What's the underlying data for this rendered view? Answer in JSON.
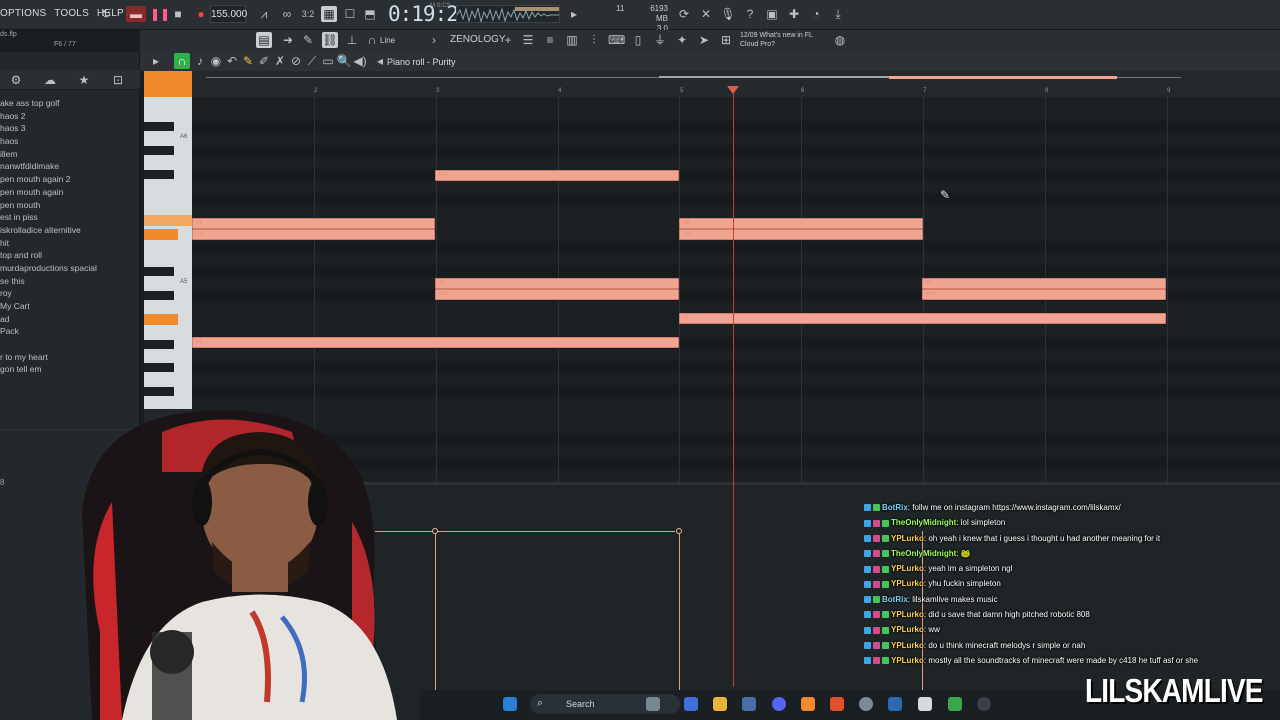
{
  "menus": [
    "OPTIONS",
    "TOOLS",
    "HELP"
  ],
  "transport": {
    "tempo": "155.000",
    "time": "0:19:28",
    "time_sub": "M:S:CS",
    "cpu": "11",
    "mem_top": "6193 MB",
    "mem_bottom": "3 0"
  },
  "plugin": "ZENOLOGY",
  "snap_label": "Line",
  "news": {
    "line1": "12/09  What's new in FL",
    "line2": "Cloud Pro?"
  },
  "file": {
    "name": "ds.flp",
    "pattern": "F6 / 77"
  },
  "piano_roll": {
    "title": "Piano roll - Purity"
  },
  "ruler": [
    "2",
    "3",
    "4",
    "5",
    "6",
    "7",
    "8",
    "9"
  ],
  "key_labels": [
    "A6",
    "A5"
  ],
  "browser_items": [
    "ake ass top golf",
    "haos 2",
    "haos 3",
    "haos",
    "illem",
    "nanwtfdidimake",
    "pen mouth again 2",
    "pen mouth again",
    "pen mouth",
    "est in piss",
    "iskrolladice alternitive",
    "hit",
    "top and roll",
    "murdaproductions spacial",
    "se this",
    "roy",
    "My Cart",
    "ad",
    "Pack",
    "",
    "r to my heart",
    "gon tell em"
  ],
  "browser_number": "8",
  "notes": [
    {
      "label": "F#6"
    },
    {
      "label": "D6"
    },
    {
      "label": "C#6"
    },
    {
      "label": "D6"
    },
    {
      "label": "C#6"
    },
    {
      "label": "A5"
    },
    {
      "label": "G#5"
    },
    {
      "label": "A5"
    },
    {
      "label": "G#5"
    },
    {
      "label": "F5"
    },
    {
      "label": "E5"
    }
  ],
  "chat": [
    {
      "user": "BotRix",
      "color": "#7fd3ff",
      "text": ": follw me on instagram https://www.instagram.com/lilskamx/"
    },
    {
      "user": "TheOnlyMidnight",
      "color": "#9cff59",
      "text": ": lol simpleton"
    },
    {
      "user": "YPLurko",
      "color": "#ffd04a",
      "text": ": oh yeah i knew that i guess i thought u had another meaning for it"
    },
    {
      "user": "TheOnlyMidnight",
      "color": "#9cff59",
      "text": ": 🐸"
    },
    {
      "user": "YPLurko",
      "color": "#ffd04a",
      "text": ": yeah im a simpleton ngl"
    },
    {
      "user": "YPLurko",
      "color": "#ffd04a",
      "text": ": yhu fuckin simpleton"
    },
    {
      "user": "BotRix",
      "color": "#7fd3ff",
      "text": ": lilskamlive makes music"
    },
    {
      "user": "YPLurko",
      "color": "#ffd04a",
      "text": ": did u save that damn high pitched robotic 808"
    },
    {
      "user": "YPLurko",
      "color": "#ffd04a",
      "text": ": ww"
    },
    {
      "user": "YPLurko",
      "color": "#ffd04a",
      "text": ": do u think minecraft melodys r simple or nah"
    },
    {
      "user": "YPLurko",
      "color": "#ffd04a",
      "text": ": mostly all the soundtracks of minecraft were made by c418 he tuff asf or she"
    }
  ],
  "taskbar": {
    "search": "Search"
  },
  "brand": "LILSKAMLIVE",
  "colors": {
    "note": "#f0a593",
    "playhead": "#c23b30",
    "accent": "#f08a2c"
  }
}
